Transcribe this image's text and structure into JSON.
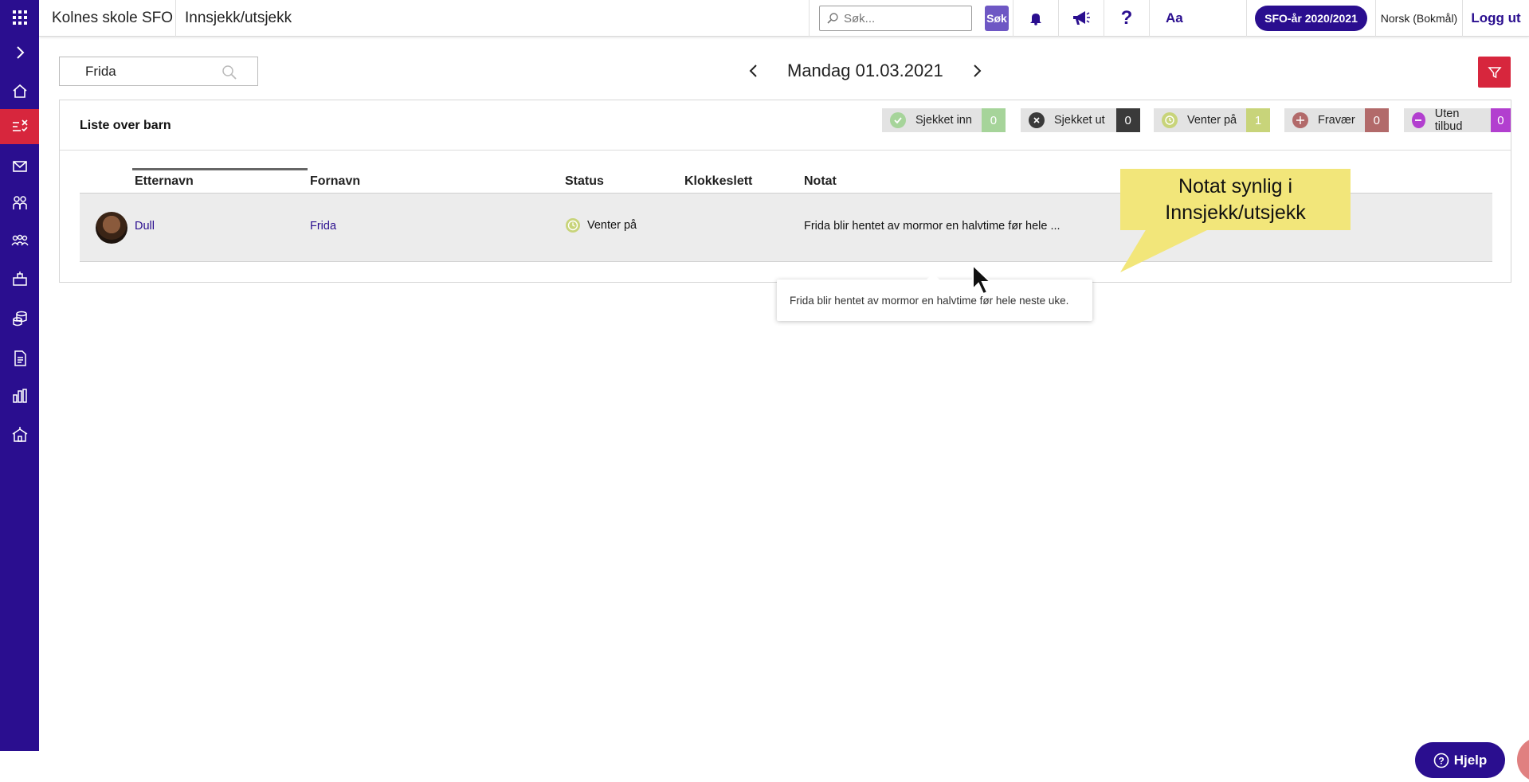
{
  "app": {
    "title": "Kolnes skole SFO",
    "page_title": "Innsjekk/utsjekk"
  },
  "topbar": {
    "search_placeholder": "Søk...",
    "search_button": "Søk",
    "font_button": "Aa",
    "year_label": "SFO-år 2020/2021",
    "language": "Norsk (Bokmål)",
    "logout": "Logg ut"
  },
  "sidebar": {
    "items": [
      "apps",
      "expand",
      "home",
      "check-in-out",
      "messages",
      "children",
      "groups",
      "activities",
      "payments",
      "documents",
      "reports",
      "school"
    ]
  },
  "filter": {
    "search_value": "Frida"
  },
  "date_nav": {
    "date": "Mandag 01.03.2021"
  },
  "panel": {
    "title": "Liste over barn"
  },
  "badges": [
    {
      "label": "Sjekket inn",
      "count": "0",
      "color": "#a6d49a"
    },
    {
      "label": "Sjekket ut",
      "count": "0",
      "color": "#3a3a3a"
    },
    {
      "label": "Venter på",
      "count": "1",
      "color": "#c8d47a"
    },
    {
      "label": "Fravær",
      "count": "0",
      "color": "#b26a6a"
    },
    {
      "label": "Uten tilbud",
      "count": "0",
      "color": "#b23fcf"
    }
  ],
  "table": {
    "headers": [
      "Etternavn",
      "Fornavn",
      "Status",
      "Klokkeslett",
      "Notat"
    ],
    "rows": [
      {
        "etternavn": "Dull",
        "fornavn": "Frida",
        "status": "Venter på",
        "klokkeslett": "",
        "notat": "Frida blir hentet av mormor en halvtime før hele ..."
      }
    ]
  },
  "tooltip": {
    "text": "Frida blir hentet av mormor en halvtime før hele neste uke."
  },
  "callout": {
    "line1": "Notat synlig i",
    "line2": "Innsjekk/utsjekk"
  },
  "help": {
    "label": "Hjelp"
  },
  "fab": {
    "label": "+"
  }
}
